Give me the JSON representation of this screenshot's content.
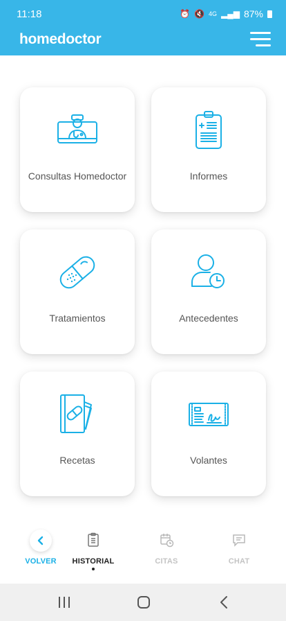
{
  "status": {
    "time": "11:18",
    "network": "4G",
    "battery": "87%"
  },
  "header": {
    "brand": "homedoctor"
  },
  "cards": [
    {
      "label": "Consultas Homedoctor",
      "icon": "doctor-monitor-icon"
    },
    {
      "label": "Informes",
      "icon": "clipboard-report-icon"
    },
    {
      "label": "Tratamientos",
      "icon": "pill-capsule-icon"
    },
    {
      "label": "Antecedentes",
      "icon": "user-history-icon"
    },
    {
      "label": "Recetas",
      "icon": "prescription-book-icon"
    },
    {
      "label": "Volantes",
      "icon": "referral-slip-icon"
    }
  ],
  "bottom_nav": {
    "back": "VOLVER",
    "history": "HISTORIAL",
    "appointments": "CITAS",
    "chat": "CHAT"
  },
  "colors": {
    "brand": "#38b6e8",
    "icon": "#1ab0e6",
    "active_nav": "#222222",
    "inactive_nav": "#c4c4c4"
  }
}
